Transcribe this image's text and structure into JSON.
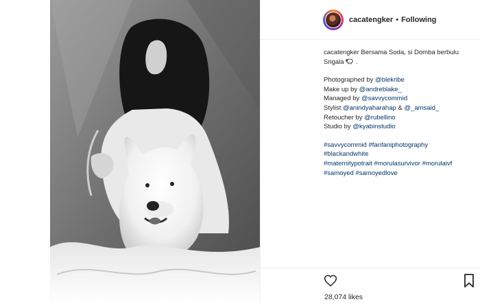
{
  "post": {
    "username": "cacatengker",
    "follow_separator": "•",
    "follow_status": "Following"
  },
  "caption": {
    "author": "cacatengker",
    "text_line1": " Bersama Soda, si Domba berbulu",
    "text_line2": "Srigala",
    "text_line2_suffix": " .",
    "emoji_icon": "sheep-icon",
    "credits": [
      {
        "label": "Photographed by ",
        "handle": "@blekribe"
      },
      {
        "label": "Make up by ",
        "handle": "@andreblake_"
      },
      {
        "label": "Managed by ",
        "handle": "@savvycommid"
      },
      {
        "label": "Stylist ",
        "handle": "@anindyaharahap",
        "mid": " & ",
        "handle2": "@_amsaid_"
      },
      {
        "label": "Retoucher by ",
        "handle": "@rubellino"
      },
      {
        "label": "Studio by ",
        "handle": "@kyabinstudio"
      }
    ],
    "hashtag_lines": [
      "#savvycommid #fanfaniphotography",
      "#blackandwhite",
      "#maternitypotrait #morulasurvivor #morulaivf",
      "#samoyed #samoyedlove"
    ]
  },
  "actions": {
    "like_icon": "heart-icon",
    "save_icon": "bookmark-icon",
    "likes_text": "28,074 likes"
  },
  "colors": {
    "text": "#262626",
    "link": "#003569",
    "border": "#efefef"
  }
}
